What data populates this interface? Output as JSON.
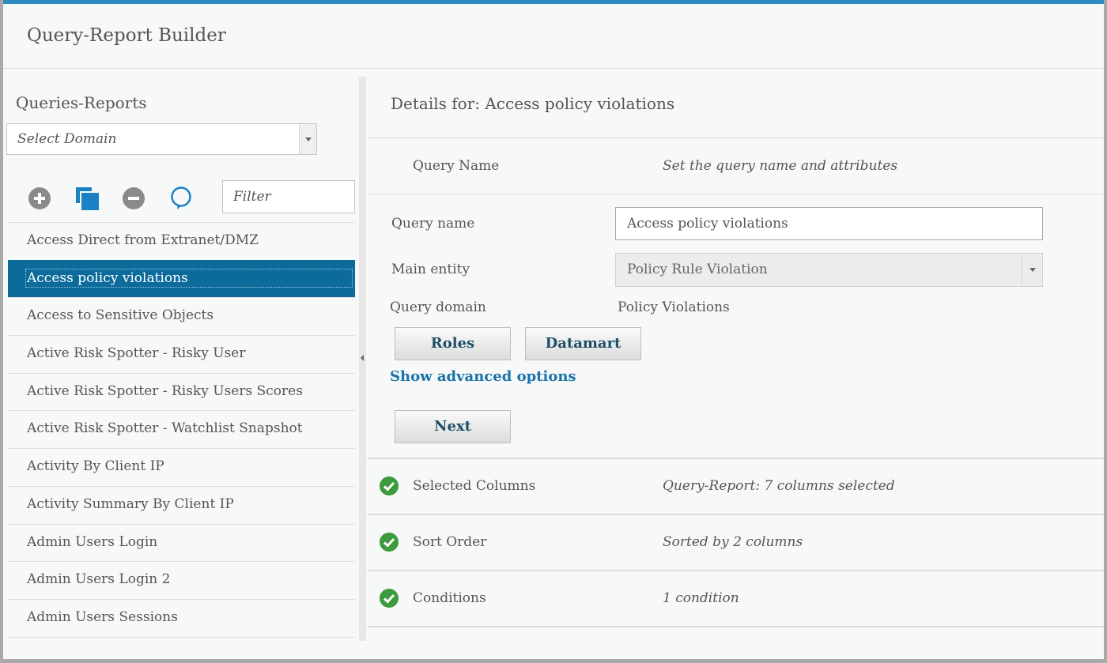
{
  "app": {
    "title": "Query-Report Builder"
  },
  "left": {
    "title": "Queries-Reports",
    "domain_select": {
      "value": "Select Domain"
    },
    "toolbar": {
      "add": "add-icon",
      "copy": "copy-icon",
      "remove": "remove-icon",
      "comment": "comment-icon"
    },
    "filter": {
      "placeholder": "Filter"
    },
    "items": [
      {
        "label": "Access Direct from Extranet/DMZ"
      },
      {
        "label": "Access policy violations",
        "selected": true
      },
      {
        "label": "Access to Sensitive Objects"
      },
      {
        "label": "Active Risk Spotter - Risky User"
      },
      {
        "label": "Active Risk Spotter - Risky Users Scores"
      },
      {
        "label": "Active Risk Spotter - Watchlist Snapshot"
      },
      {
        "label": "Activity By Client IP"
      },
      {
        "label": "Activity Summary By Client IP"
      },
      {
        "label": "Admin Users Login"
      },
      {
        "label": "Admin Users Login 2"
      },
      {
        "label": "Admin Users Sessions"
      }
    ]
  },
  "details": {
    "title": "Details for: Access policy violations",
    "query_step": {
      "label": "Query Name",
      "desc": "Set the query name and attributes"
    },
    "form": {
      "query_name_label": "Query name",
      "query_name_value": "Access policy violations",
      "main_entity_label": "Main entity",
      "main_entity_value": "Policy Rule Violation",
      "query_domain_label": "Query domain",
      "query_domain_value": "Policy Violations",
      "roles_button": "Roles",
      "datamart_button": "Datamart",
      "advanced_link": "Show advanced options",
      "next_button": "Next"
    },
    "steps": [
      {
        "label": "Selected Columns",
        "desc": "Query-Report: 7 columns selected",
        "status": "complete"
      },
      {
        "label": "Sort Order",
        "desc": "Sorted by 2 columns",
        "status": "complete"
      },
      {
        "label": "Conditions",
        "desc": "1 condition",
        "status": "complete"
      }
    ]
  },
  "colors": {
    "accent": "#2e8cc0",
    "selected": "#0d6b9c",
    "link": "#1b73a8",
    "check": "#3d9a3d"
  }
}
